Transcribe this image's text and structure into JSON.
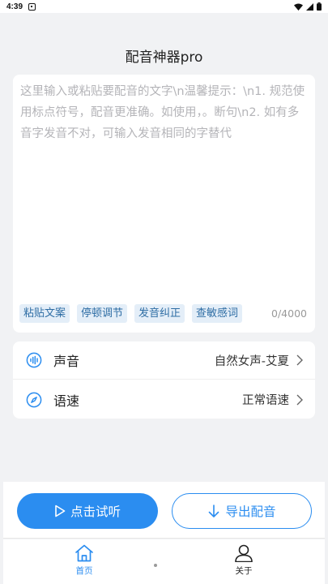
{
  "status_bar": {
    "time": "4:39"
  },
  "app": {
    "title": "配音神器pro"
  },
  "editor": {
    "placeholder": "这里输入或粘贴要配音的文字\\n温馨提示：\\n1. 规范使用标点符号，配音更准确。如使用，。断句\\n2. 如有多音字发音不对，可输入发音相同的字替代",
    "chips": [
      "粘贴文案",
      "停顿调节",
      "发音纠正",
      "查敏感词"
    ],
    "counter": "0/4000"
  },
  "settings": {
    "voice": {
      "label": "声音",
      "value": "自然女声-艾夏",
      "icon": "waveform-icon"
    },
    "speed": {
      "label": "语速",
      "value": "正常语速",
      "icon": "compass-icon"
    }
  },
  "actions": {
    "play_label": "点击试听",
    "export_label": "导出配音"
  },
  "tabs": {
    "home": "首页",
    "about": "关于"
  },
  "colors": {
    "accent": "#2b8df0",
    "chip_bg": "#e4eef8",
    "chip_text": "#2e6da4",
    "background": "#f1f2f4"
  }
}
